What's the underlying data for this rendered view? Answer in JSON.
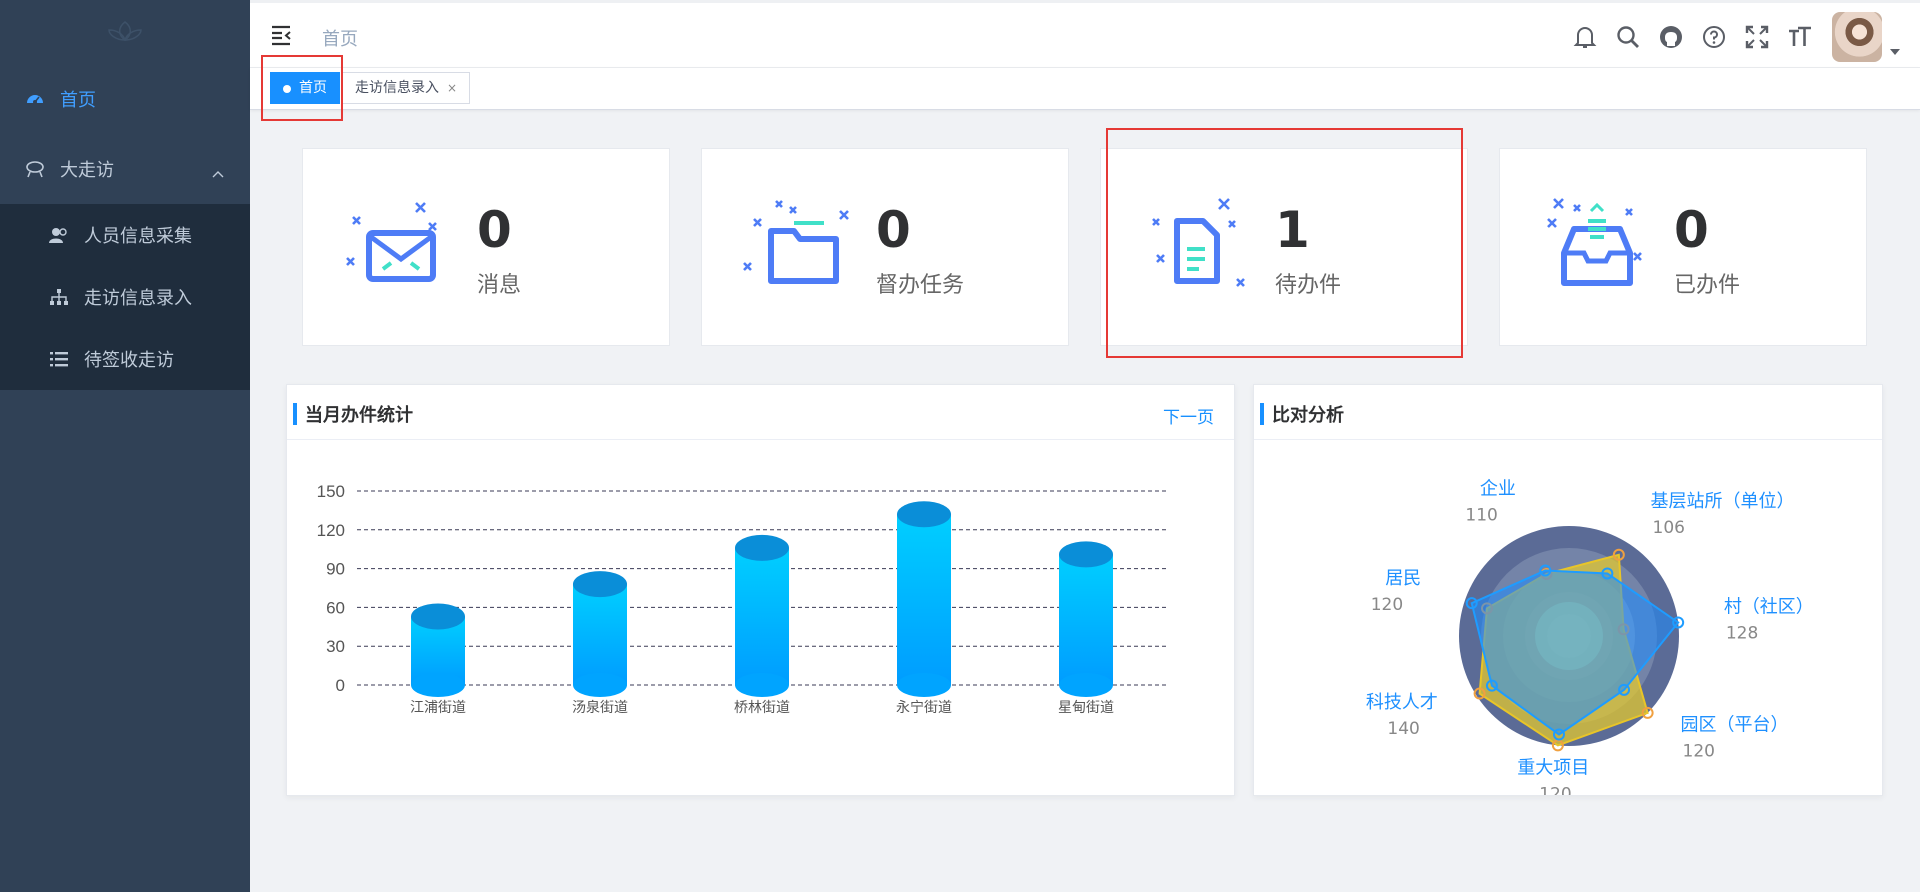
{
  "sidebar": {
    "items": [
      {
        "label": "首页",
        "icon": "dashboard-icon",
        "active": true
      },
      {
        "label": "大走访",
        "icon": "visit-icon",
        "expanded": true,
        "children": [
          {
            "label": "人员信息采集",
            "icon": "peoples-icon"
          },
          {
            "label": "走访信息录入",
            "icon": "tree-icon"
          },
          {
            "label": "待签收走访",
            "icon": "list-icon"
          }
        ]
      }
    ]
  },
  "navbar": {
    "breadcrumb": "首页",
    "icons": [
      "bell-icon",
      "search-icon",
      "github-icon",
      "question-icon",
      "fullscreen-icon",
      "font-size-icon"
    ]
  },
  "tags": [
    {
      "label": "首页",
      "active": true
    },
    {
      "label": "走访信息录入",
      "close": "×"
    }
  ],
  "stats": [
    {
      "value": "0",
      "label": "消息",
      "icon": "mail-icon"
    },
    {
      "value": "0",
      "label": "督办任务",
      "icon": "folder-icon"
    },
    {
      "value": "1",
      "label": "待办件",
      "icon": "document-icon"
    },
    {
      "value": "0",
      "label": "已办件",
      "icon": "inbox-icon"
    }
  ],
  "panels": {
    "monthly": {
      "title": "当月办件统计",
      "link": "下一页"
    },
    "compare": {
      "title": "比对分析"
    }
  },
  "colors": {
    "accent": "#1890ff",
    "sidebar": "#304156",
    "sidebar_sub": "#1f2d3d",
    "highlight": "#e53935"
  },
  "chart_data": [
    {
      "type": "bar",
      "categories": [
        "江浦街道",
        "汤泉街道",
        "桥林街道",
        "永宁街道",
        "星甸街道"
      ],
      "values": [
        53,
        78,
        106,
        132,
        101
      ],
      "ylim": [
        0,
        150
      ],
      "yticks": [
        0,
        30,
        60,
        90,
        120,
        150
      ],
      "grid": true
    },
    {
      "type": "radar",
      "indicators": [
        {
          "name": "基层站所（单位）",
          "value": 106
        },
        {
          "name": "村（社区）",
          "value": 128
        },
        {
          "name": "园区（平台）",
          "value": 120
        },
        {
          "name": "重大项目",
          "value": 120
        },
        {
          "name": "科技人才",
          "value": 140
        },
        {
          "name": "居民",
          "value": 120
        },
        {
          "name": "企业",
          "value": 110
        }
      ],
      "series": [
        {
          "values": [
            100,
            150,
            105,
            135,
            125,
            140,
            95
          ]
        },
        {
          "values": [
            130,
            75,
            150,
            150,
            145,
            118,
            90
          ]
        }
      ],
      "max": 150
    }
  ]
}
